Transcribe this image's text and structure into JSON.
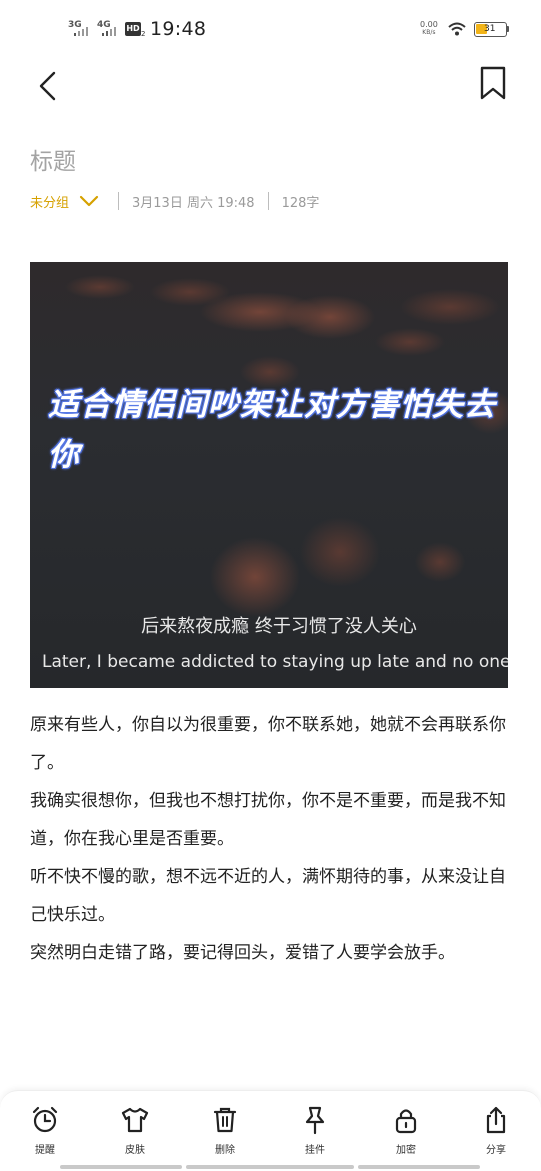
{
  "status_bar": {
    "sim1_label": "3G",
    "sim2_label": "4G",
    "hd_label": "HD",
    "hd_sub": "2",
    "time": "19:48",
    "net_speed_value": "0.00",
    "net_speed_unit": "KB/s",
    "battery_level": "31",
    "battery_percent_fill": 0.31,
    "battery_color": "#f2b418"
  },
  "nav": {
    "back_icon": "chevron-left-icon",
    "bookmark_icon": "bookmark-icon"
  },
  "note": {
    "title_placeholder": "标题",
    "group": "未分组",
    "date": "3月13日 周六 19:48",
    "word_count": "128字",
    "image": {
      "overlay_title": "适合情侣间吵架让对方害怕失去你",
      "subtitle_cn": "后来熬夜成瘾 终于习惯了没人关心",
      "subtitle_en": "Later, I became addicted to staying up late and no one"
    },
    "paragraphs": [
      "原来有些人，你自以为很重要，你不联系她，她就不会再联系你了。",
      "我确实很想你，但我也不想打扰你，你不是不重要，而是我不知道，你在我心里是否重要。",
      "听不快不慢的歌，想不远不近的人，满怀期待的事，从来没让自己快乐过。",
      "突然明白走错了路，要记得回头，爱错了人要学会放手。"
    ]
  },
  "toolbar": {
    "items": [
      {
        "label": "提醒",
        "icon": "alarm-clock-icon"
      },
      {
        "label": "皮肤",
        "icon": "tshirt-icon"
      },
      {
        "label": "删除",
        "icon": "trash-icon"
      },
      {
        "label": "挂件",
        "icon": "pin-icon"
      },
      {
        "label": "加密",
        "icon": "lock-icon"
      },
      {
        "label": "分享",
        "icon": "share-icon"
      }
    ]
  },
  "colors": {
    "accent": "#d6a100",
    "muted": "#9a9a9a",
    "overlay_glow": "#5b7de8"
  }
}
